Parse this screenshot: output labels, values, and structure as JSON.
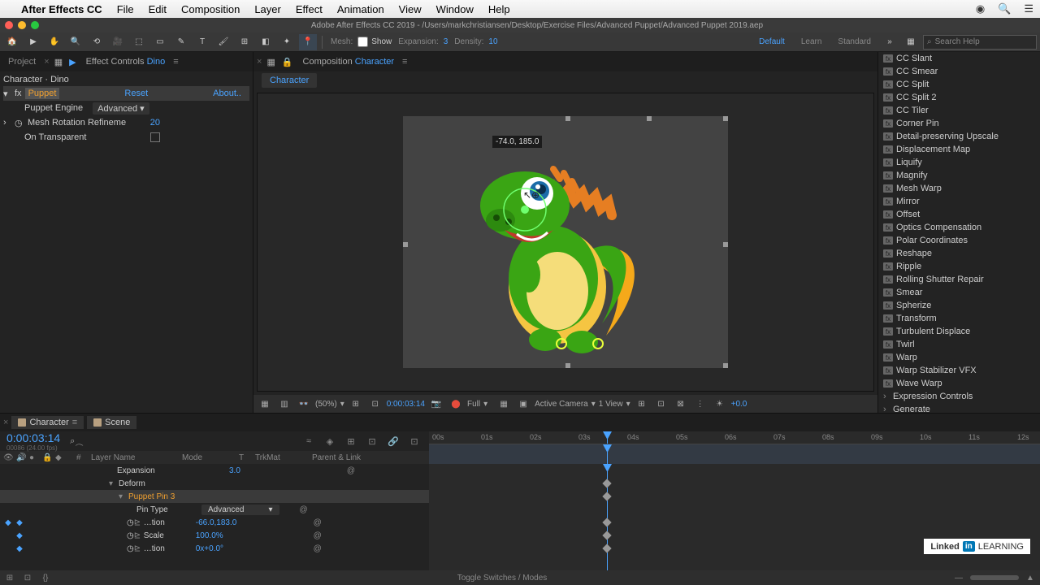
{
  "menubar": {
    "app": "After Effects CC",
    "items": [
      "File",
      "Edit",
      "Composition",
      "Layer",
      "Effect",
      "Animation",
      "View",
      "Window",
      "Help"
    ]
  },
  "titlebar": {
    "title": "Adobe After Effects CC 2019 - /Users/markchristiansen/Desktop/Exercise Files/Advanced Puppet/Advanced Puppet 2019.aep"
  },
  "toolbar": {
    "mesh_label": "Mesh:",
    "show_label": "Show",
    "expansion_label": "Expansion:",
    "expansion_value": "3",
    "density_label": "Density:",
    "density_value": "10",
    "workspaces": {
      "default": "Default",
      "learn": "Learn",
      "standard": "Standard"
    },
    "search_placeholder": "Search Help"
  },
  "panels": {
    "project": "Project",
    "effectcontrols_prefix": "Effect Controls ",
    "effectcontrols_target": "Dino",
    "composition_prefix": "Composition ",
    "composition_name": "Character",
    "comptab": "Character"
  },
  "effectcontrols": {
    "header": "Character · Dino",
    "fx_name": "Puppet",
    "reset": "Reset",
    "about": "About..",
    "engine_label": "Puppet Engine",
    "engine_value": "Advanced",
    "mesh_rot_label": "Mesh Rotation Refineme",
    "mesh_rot_value": "20",
    "transparent_label": "On Transparent"
  },
  "viewer": {
    "coords": "-74.0, 185.0",
    "zoom": "(50%)",
    "timecode": "0:00:03:14",
    "resolution": "Full",
    "camera": "Active Camera",
    "views": "1 View",
    "exposure": "+0.0"
  },
  "effects_list": [
    "CC Slant",
    "CC Smear",
    "CC Split",
    "CC Split 2",
    "CC Tiler",
    "Corner Pin",
    "Detail-preserving Upscale",
    "Displacement Map",
    "Liquify",
    "Magnify",
    "Mesh Warp",
    "Mirror",
    "Offset",
    "Optics Compensation",
    "Polar Coordinates",
    "Reshape",
    "Ripple",
    "Rolling Shutter Repair",
    "Smear",
    "Spherize",
    "Transform",
    "Turbulent Displace",
    "Twirl",
    "Warp",
    "Warp Stabilizer VFX",
    "Wave Warp"
  ],
  "effects_categories": [
    "Expression Controls",
    "Generate"
  ],
  "timeline": {
    "tabs": {
      "active": "Character",
      "other": "Scene"
    },
    "timecode": "0:00:03:14",
    "frame_info": "00086 (24.00 fps)",
    "cols": {
      "layername": "Layer Name",
      "mode": "Mode",
      "t": "T",
      "trkmat": "TrkMat",
      "parent": "Parent & Link"
    },
    "rows": {
      "expansion": {
        "label": "Expansion",
        "value": "3.0"
      },
      "deform": {
        "label": "Deform"
      },
      "pin": {
        "label": "Puppet Pin 3"
      },
      "pintype": {
        "label": "Pin Type",
        "value": "Advanced"
      },
      "position": {
        "label": "…tion",
        "value": "-66.0,183.0"
      },
      "scale": {
        "label": "Scale",
        "value": "100.0%"
      },
      "rotation": {
        "label": "…tion",
        "value": "0x+0.0°"
      }
    },
    "ruler": [
      "00s",
      "01s",
      "02s",
      "03s",
      "04s",
      "05s",
      "06s",
      "07s",
      "08s",
      "09s",
      "10s",
      "11s",
      "12s"
    ],
    "footer": "Toggle Switches / Modes"
  },
  "branding": {
    "linkedin": "Linked",
    "in": "in",
    "learning": "LEARNING"
  }
}
